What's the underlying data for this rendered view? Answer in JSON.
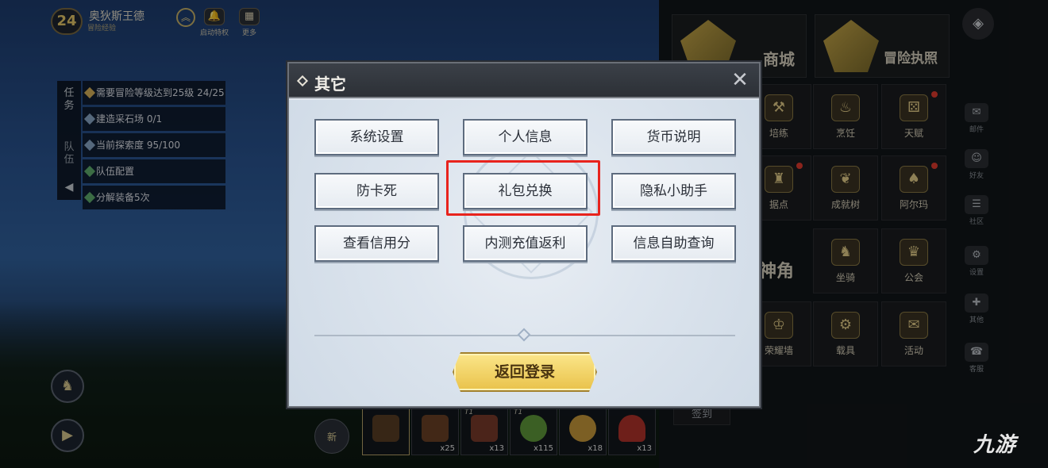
{
  "player": {
    "level": "24",
    "name": "奥狄斯王德",
    "exp_label": "冒险经验"
  },
  "top_buttons": [
    {
      "label": "启动特权",
      "icon": "bell-icon"
    },
    {
      "label": "更多",
      "icon": "grid-icon"
    }
  ],
  "quest_panel": {
    "tabs": [
      "任务",
      "队伍"
    ],
    "items": [
      "需要冒险等级达到25级 24/25",
      "建造采石场 0/1",
      "当前探索度 95/100",
      "队伍配置",
      "分解装备5次"
    ]
  },
  "right_menu": {
    "top": [
      {
        "label": "商城"
      },
      {
        "label": "冒险执照"
      }
    ],
    "tiles": [
      "培练",
      "烹饪",
      "天赋",
      "据点",
      "成就树",
      "阿尔玛",
      "坐骑",
      "公会",
      "载具",
      "活动"
    ],
    "side": [
      "邮件",
      "好友",
      "社区",
      "设置",
      "其他",
      "客服"
    ],
    "big_labels": [
      "神角",
      "荣耀墙"
    ],
    "sign_in": "签到"
  },
  "hotbar": {
    "new_label": "新",
    "slots": [
      {
        "tag": "",
        "count": "",
        "color": "#5a3e25"
      },
      {
        "tag": "",
        "count": "x25",
        "color": "#6b4226"
      },
      {
        "tag": "T1",
        "count": "x13",
        "color": "#7a3a2a"
      },
      {
        "tag": "T1",
        "count": "x115",
        "color": "#5f9a3a"
      },
      {
        "tag": "",
        "count": "x18",
        "color": "#c99a3a"
      },
      {
        "tag": "",
        "count": "x13",
        "color": "#b2332a"
      }
    ]
  },
  "dialog": {
    "title": "其它",
    "options": [
      "系统设置",
      "个人信息",
      "货币说明",
      "防卡死",
      "礼包兑换",
      "隐私小助手",
      "查看信用分",
      "内测充值返利",
      "信息自助查询"
    ],
    "highlighted_option": "礼包兑换",
    "back_button": "返回登录"
  },
  "watermark": "九游",
  "colors": {
    "highlight": "#e8231d",
    "gold": "#e9c24a"
  }
}
